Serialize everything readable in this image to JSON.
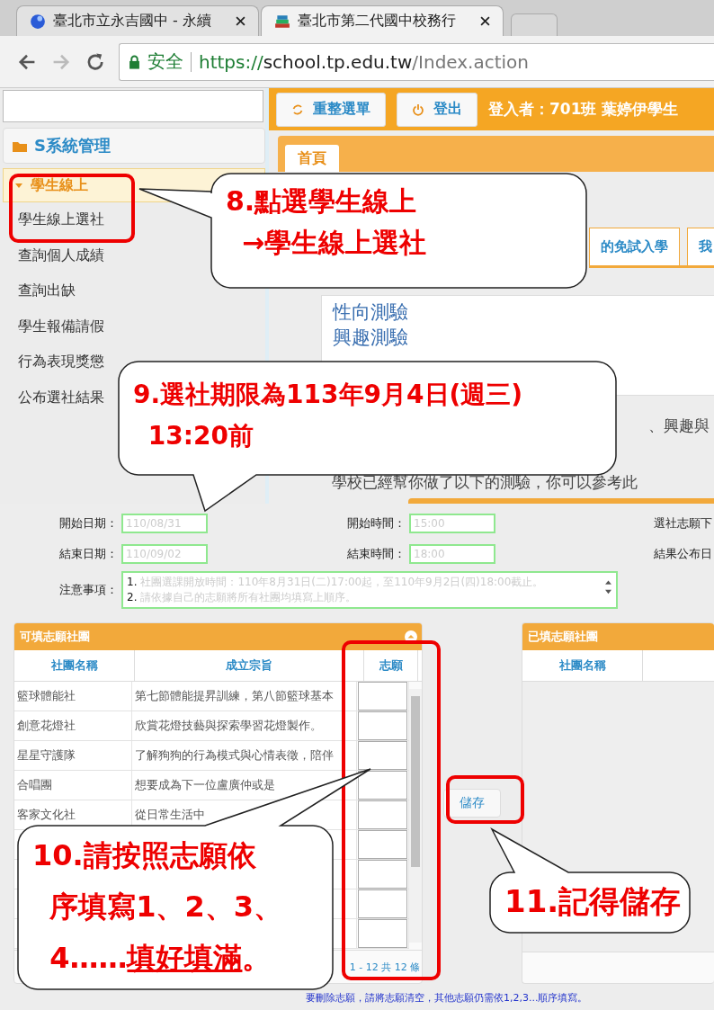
{
  "browser": {
    "tabs": [
      {
        "title": "臺北市立永吉國中 - 永續",
        "selected": false
      },
      {
        "title": "臺北市第二代國中校務行",
        "selected": true
      }
    ],
    "security": "安全",
    "url_parts": [
      {
        "text": "https://",
        "kind": "scheme"
      },
      {
        "text": "school.tp.edu.tw",
        "kind": "host"
      },
      {
        "text": "/Index.action",
        "kind": "path"
      }
    ]
  },
  "sidebar": {
    "section": "S系統管理",
    "group": {
      "label": "學生線上",
      "expanded": true,
      "items": [
        {
          "label": "學生線上選社"
        },
        {
          "label": "查詢個人成績"
        },
        {
          "label": "查詢出缺"
        },
        {
          "label": "學生報備請假"
        },
        {
          "label": "行為表現獎懲"
        },
        {
          "label": "公布選社結果"
        }
      ]
    }
  },
  "toolbar": {
    "buttons": [
      {
        "label": "重整選單"
      },
      {
        "label": "登出"
      }
    ],
    "user": "登入者：701班 葉婷伊學生"
  },
  "main_tabs": [
    {
      "label": "首頁",
      "selected": true
    }
  ],
  "sub_tabs": [
    {
      "label": "的免試入學"
    },
    {
      "label": "我"
    }
  ],
  "tests": [
    "性向測驗",
    "興趣測驗"
  ],
  "intro": [
    "、興趣與",
    "學校已經幫你做了以下的測驗，你可以參考此"
  ],
  "form": {
    "rows": [
      [
        {
          "label": "開始日期：",
          "value": "110/08/31"
        },
        {
          "label": "開始時間：",
          "value": "15:00"
        },
        {
          "label": "選社志願下"
        }
      ],
      [
        {
          "label": "結束日期：",
          "value": "110/09/02"
        },
        {
          "label": "結束時間：",
          "value": "18:00"
        },
        {
          "label": "結果公布日"
        }
      ]
    ],
    "notes": {
      "label": "注意事項：",
      "lines": [
        {
          "number": "1.",
          "text": "社團選課開放時間：110年8月31日(二)17:00起，至110年9月2日(四)18:00截止。"
        },
        {
          "number": "2.",
          "text": "請依據自己的志願將所有社團均填寫上順序。"
        }
      ]
    }
  },
  "available": {
    "title": "可填志願社團",
    "columns": [
      "社團名稱",
      "成立宗旨",
      "志願"
    ],
    "rows": [
      {
        "kind": "club",
        "name": "籃球體能社",
        "purpose": "第七節體能提昇訓練，第八節籃球基本"
      },
      {
        "kind": "club",
        "name": "創意花燈社",
        "purpose": "欣賞花燈技藝與探索學習花燈製作。"
      },
      {
        "kind": "club",
        "name": "星星守護隊",
        "purpose": "了解狗狗的行為模式與心情表徵，陪伴"
      },
      {
        "kind": "club",
        "name": "合唱團",
        "purpose": "想要成為下一位盧廣仲或是"
      },
      {
        "kind": "club",
        "name": "客家文化社",
        "purpose": "從日常生活中"
      },
      {
        "kind": "covered"
      },
      {
        "kind": "covered"
      },
      {
        "kind": "covered"
      },
      {
        "kind": "covered"
      }
    ],
    "pager": "1 - 12 共 12 條"
  },
  "save_button": "儲存",
  "chosen": {
    "title": "已填志願社團",
    "columns": [
      "社團名稱"
    ]
  },
  "footer_note": "要刪除志願，請將志願清空，其他志願仍需依1,2,3...順序填寫。",
  "callouts": [
    {
      "lines": [
        [
          {
            "text": "8.點選學生線上"
          }
        ],
        [
          {
            "text": "→學生線上選社"
          }
        ]
      ]
    },
    {
      "lines": [
        [
          {
            "text": "9.選社期限為113年9月4日(週三)"
          }
        ],
        [
          {
            "text": "13:20前"
          }
        ]
      ]
    },
    {
      "lines": [
        [
          {
            "text": "10.請按照志願依"
          }
        ],
        [
          {
            "text": "序填寫1、2、3、"
          }
        ],
        [
          {
            "text": "4……"
          },
          {
            "text": "填好填滿",
            "underline": true
          },
          {
            "text": "。"
          }
        ]
      ]
    },
    {
      "lines": [
        [
          {
            "text": "11.記得儲存"
          }
        ]
      ]
    }
  ]
}
